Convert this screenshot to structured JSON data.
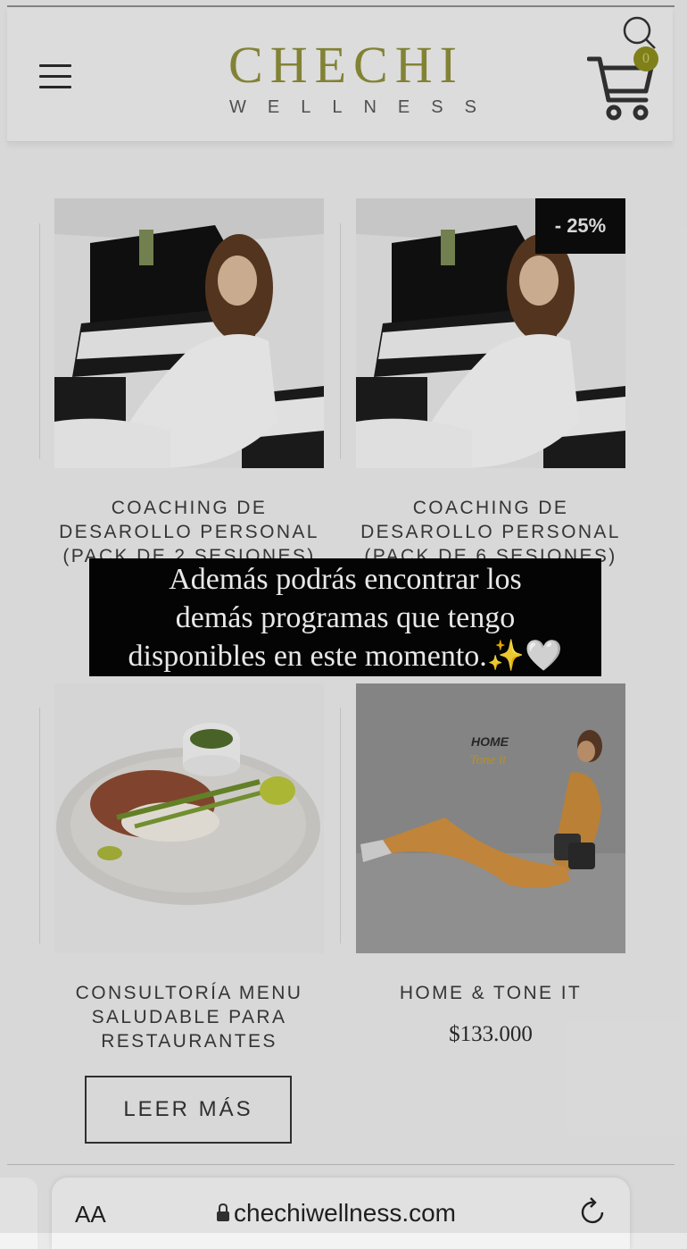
{
  "header": {
    "logo_main": "CHECHI",
    "logo_sub": "WELLNESS",
    "cart_count": "0",
    "icons": [
      "hamburger-menu-icon",
      "search-icon",
      "cart-icon"
    ]
  },
  "products": [
    {
      "title_lines": [
        "COACHING DE",
        "DESAROLLO PERSONAL",
        "(PACK DE 2 SESIONES)"
      ],
      "image": "woman-at-piano"
    },
    {
      "title_lines": [
        "COACHING DE",
        "DESAROLLO PERSONAL",
        "(PACK DE 6 SESIONES)"
      ],
      "image": "woman-at-piano",
      "badge": "- 25%"
    },
    {
      "title_lines": [
        "CONSULTORÍA MENU",
        "SALUDABLE PARA",
        "RESTAURANTES"
      ],
      "image": "healthy-plate",
      "button": "LEER MÁS"
    },
    {
      "title_lines": [
        "HOME & TONE IT"
      ],
      "image": "workout-woman",
      "price": "$133.000",
      "image_text": [
        "HOME",
        "Tone it"
      ]
    }
  ],
  "story_caption": {
    "lines": [
      "Además podrás encontrar los",
      "demás programas que tengo",
      "disponibles en este momento.✨🤍"
    ]
  },
  "browser": {
    "text_size_label": "AA",
    "url": "chechiwellness.com",
    "icons": [
      "lock-icon",
      "reload-icon"
    ]
  },
  "colors": {
    "logo": "#8c8c3a",
    "badge_bg": "#0c0c0c",
    "caption_bg": "#050505",
    "cart_badge": "#8a8a1e"
  }
}
